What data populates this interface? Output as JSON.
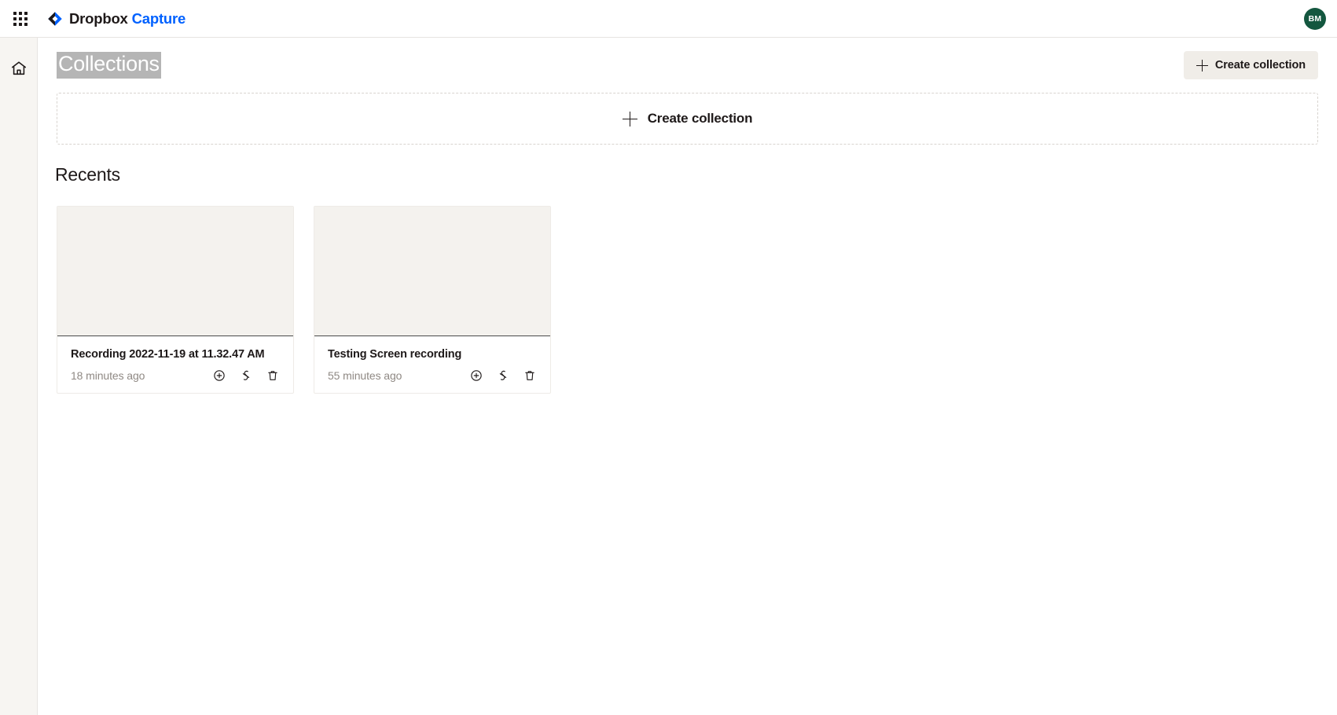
{
  "topbar": {
    "apps_icon": "apps-grid-icon",
    "brand_primary": "Dropbox",
    "brand_secondary": "Capture",
    "avatar_initials": "BM",
    "avatar_color": "#14573f",
    "accent_color": "#0061ff"
  },
  "sidebar": {
    "items": [
      {
        "icon": "home-icon",
        "label": "Home"
      }
    ]
  },
  "page": {
    "title": "Collections",
    "title_selected": true,
    "create_button_label": "Create collection",
    "dropzone_label": "Create collection",
    "section_title": "Recents"
  },
  "recents": {
    "cards": [
      {
        "title": "Recording 2022-11-19 at 11.32.47 AM",
        "time": "18 minutes ago",
        "actions": [
          {
            "icon": "add-to-collection-icon",
            "label": "Add to collection"
          },
          {
            "icon": "share-link-icon",
            "label": "Copy link"
          },
          {
            "icon": "trash-icon",
            "label": "Delete"
          }
        ]
      },
      {
        "title": "Testing Screen recording",
        "time": "55 minutes ago",
        "actions": [
          {
            "icon": "add-to-collection-icon",
            "label": "Add to collection"
          },
          {
            "icon": "share-link-icon",
            "label": "Copy link"
          },
          {
            "icon": "trash-icon",
            "label": "Delete"
          }
        ]
      }
    ]
  }
}
